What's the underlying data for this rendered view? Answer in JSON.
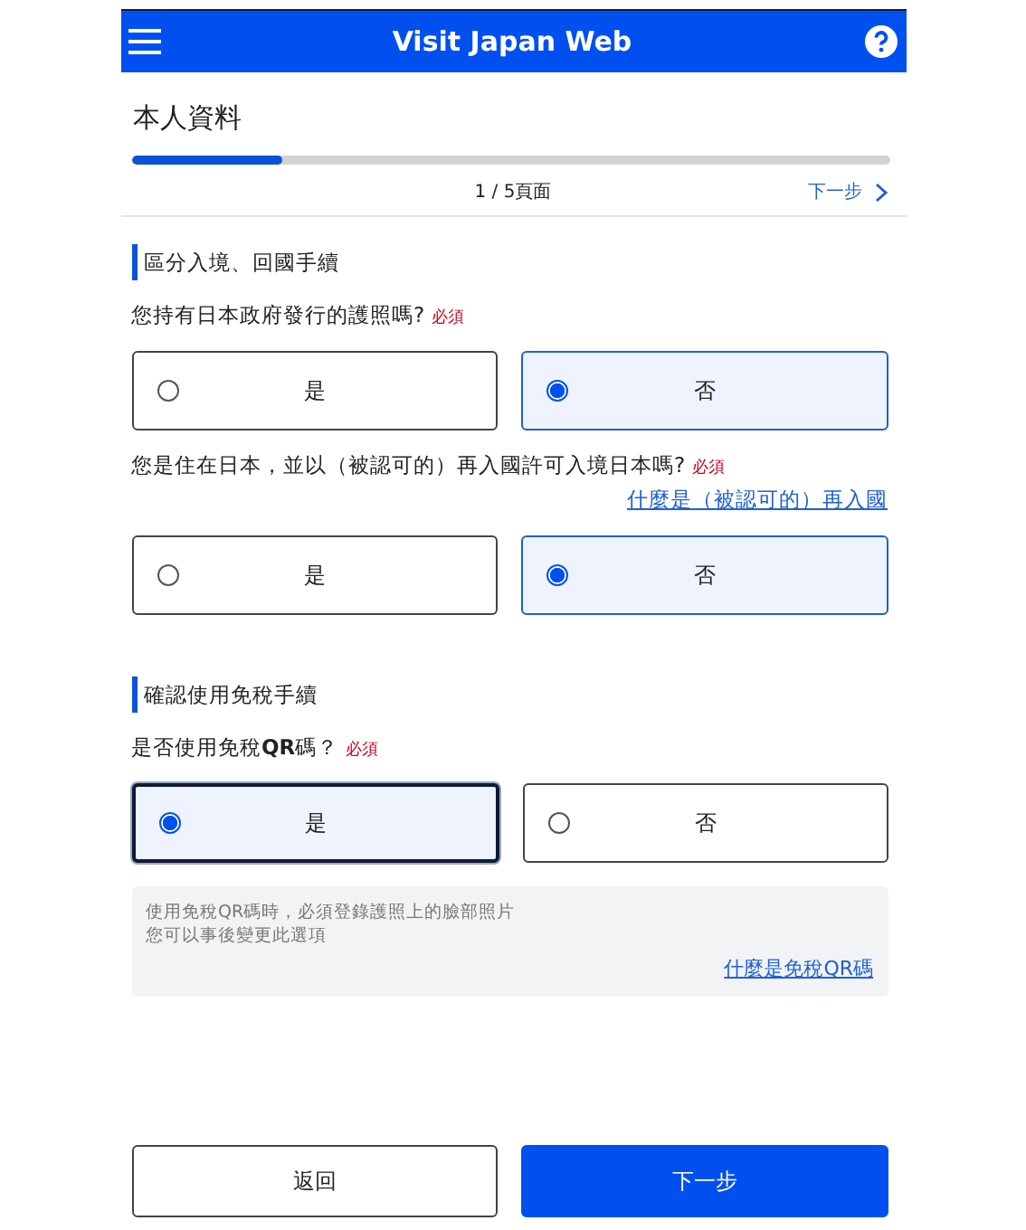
{
  "header": {
    "title": "Visit Japan Web"
  },
  "page": {
    "title": "本人資料",
    "progress": {
      "level": 0.2
    },
    "step": "1 / 5頁面",
    "next_link": "下一步"
  },
  "sections": [
    {
      "heading": "區分入境、回國手續",
      "questions": [
        {
          "text": "您持有日本政府發行的護照嗎?",
          "required": "必須",
          "options": [
            {
              "label": "是",
              "selected": false,
              "focused": false
            },
            {
              "label": "否",
              "selected": true,
              "focused": false
            }
          ]
        },
        {
          "text": "您是住在日本，並以（被認可的）再入國許可入境日本嗎?",
          "required": "必須",
          "link": "什麼是（被認可的）再入國",
          "options": [
            {
              "label": "是",
              "selected": false,
              "focused": false
            },
            {
              "label": "否",
              "selected": true,
              "focused": false
            }
          ]
        }
      ]
    },
    {
      "heading": "確認使用免稅手續",
      "questions": [
        {
          "text": "是否使用免稅**QR**碼？",
          "required": "必須",
          "options": [
            {
              "label": "是",
              "selected": true,
              "focused": true
            },
            {
              "label": "否",
              "selected": false,
              "focused": false
            }
          ],
          "note": {
            "lines": [
              "使用免稅QR碼時，必須登錄護照上的臉部照片",
              "您可以事後變更此選項"
            ],
            "link": "什麼是免稅QR碼"
          }
        }
      ]
    }
  ],
  "buttons": [
    {
      "label": "返回",
      "kind": "secondary"
    },
    {
      "label": "下一步",
      "kind": "primary"
    }
  ]
}
